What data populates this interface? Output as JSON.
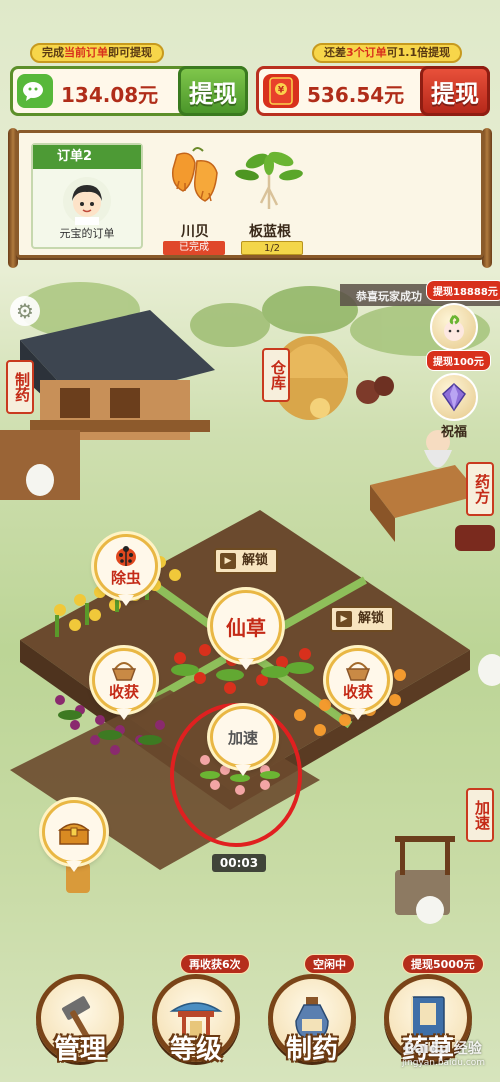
{
  "top": {
    "left_hint_pre": "完成",
    "left_hint_red": "当前订单",
    "left_hint_post": "即可提现",
    "right_hint_pre": "还差",
    "right_hint_red": "3个订单",
    "right_hint_post": "可1.1倍提现",
    "left_amount": "134.08元",
    "right_amount": "536.54元",
    "withdraw_label": "提现"
  },
  "order": {
    "title": "订单2",
    "owner": "元宝的订单",
    "items": [
      {
        "name": "川贝",
        "status": "已完成"
      },
      {
        "name": "板蓝根",
        "status": "1/2"
      }
    ]
  },
  "map": {
    "marquee": "恭喜玩家成功",
    "side_right": [
      {
        "tag": "提现18888元",
        "label": "仙草"
      },
      {
        "tag": "提现100元",
        "label": "祝福"
      }
    ],
    "signs": {
      "make_medicine": "制药",
      "warehouse": "仓库",
      "prescription": "药方",
      "speedup_side": "加速"
    },
    "bubbles": {
      "pest": "除虫",
      "herb": "仙草",
      "harvest_left": "收获",
      "harvest_right": "收获",
      "speedup": "加速"
    },
    "unlock_label": "解锁",
    "timer": "00:03"
  },
  "nav": [
    {
      "label": "管理",
      "tag": ""
    },
    {
      "label": "等级",
      "tag": "再收获6次"
    },
    {
      "label": "制药",
      "tag": "空闲中"
    },
    {
      "label": "药草",
      "tag": "提现5000元"
    }
  ],
  "watermark": "Baidu 经验",
  "watermark_url": "jingyan.baidu.com",
  "colors": {
    "green_btn": "#55a532",
    "red_btn": "#c4301c",
    "accent_red": "#d8301c",
    "gold": "#f7d64a"
  }
}
